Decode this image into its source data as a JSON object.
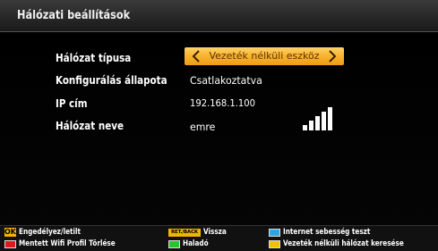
{
  "header": {
    "title": "Hálózati beállítások"
  },
  "settings": {
    "network_type": {
      "label": "Hálózat típusa",
      "value": "Vezeték nélküli eszköz"
    },
    "config_status": {
      "label": "Konfigurálás állapota",
      "value": "Csatlakoztatva"
    },
    "ip_address": {
      "label": "IP cím",
      "value": "192.168.1.100"
    },
    "network_name": {
      "label": "Hálózat neve",
      "value": "emre",
      "signal_strength_bars": 5,
      "signal_icon": "signal-strength-icon"
    }
  },
  "footer": {
    "hints": [
      {
        "key": "OK",
        "key_color": "#f2b400",
        "text": "Engedélyez/letilt"
      },
      {
        "key": "RET./BACK",
        "key_color": "#f2b400",
        "text": "Vissza"
      },
      {
        "key_color": "#29a8e6",
        "text": "Internet sebesség teszt"
      },
      {
        "key_color": "#e3161e",
        "text": "Mentett Wifi Profil Törlése"
      },
      {
        "key_color": "#2bc42f",
        "text": "Haladó"
      },
      {
        "key_color": "#f2c200",
        "text": "Vezeték nélküli hálózat keresése"
      }
    ]
  },
  "colors": {
    "selector_accent": "#f9b531",
    "background": "#000000"
  }
}
